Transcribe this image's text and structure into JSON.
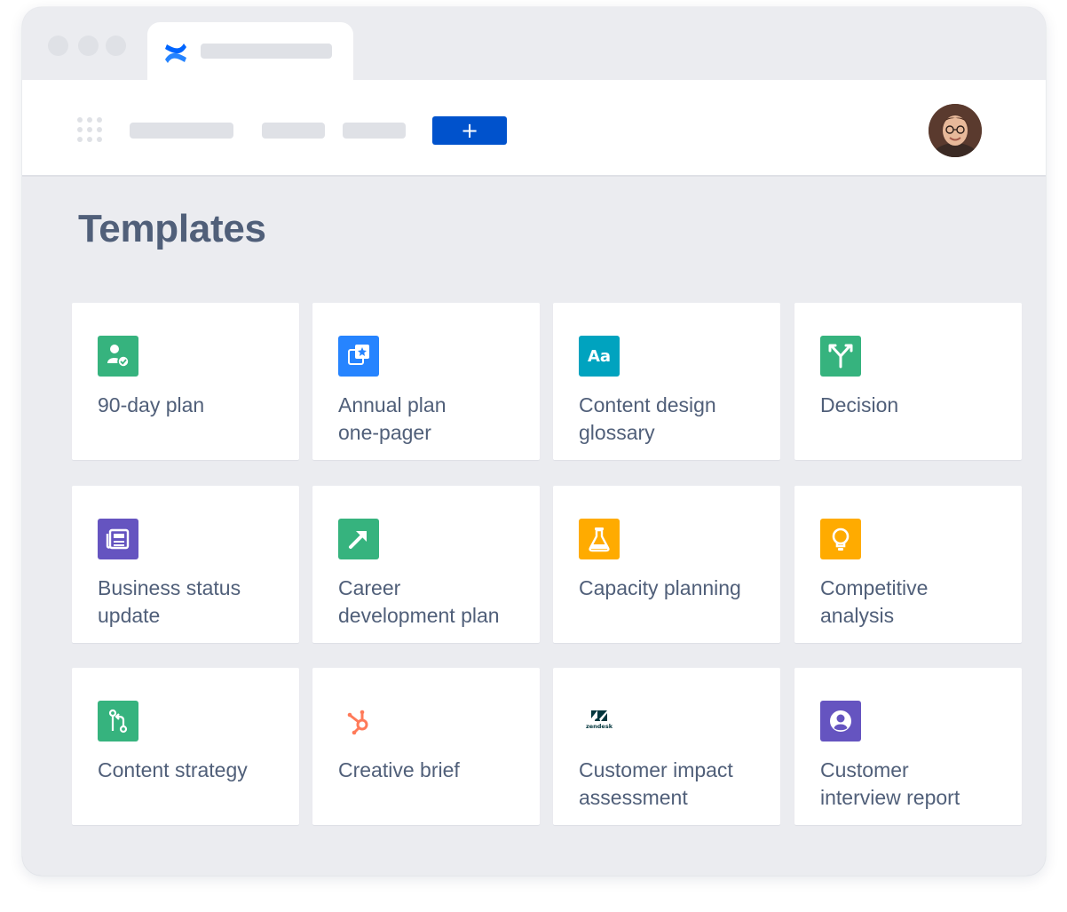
{
  "create_button": {
    "label": "+"
  },
  "page": {
    "title": "Templates"
  },
  "colors": {
    "primary": "#0052cc",
    "heading": "#505f79",
    "background": "#ebecf0",
    "placeholder": "#dfe1e6"
  },
  "templates": [
    {
      "label": "90-day plan",
      "icon": "person-check-icon",
      "icon_bg": "#36b37e"
    },
    {
      "label": "Annual plan\none-pager",
      "icon": "calendar-star-icon",
      "icon_bg": "#2684ff"
    },
    {
      "label": "Content design\nglossary",
      "icon": "text-aa-icon",
      "icon_bg": "#00a3bf"
    },
    {
      "label": "Decision",
      "icon": "fork-arrow-icon",
      "icon_bg": "#36b37e"
    },
    {
      "label": "Business status\nupdate",
      "icon": "newspaper-icon",
      "icon_bg": "#6554c0"
    },
    {
      "label": "Career\ndevelopment plan",
      "icon": "arrow-up-right-icon",
      "icon_bg": "#36b37e"
    },
    {
      "label": "Capacity planning",
      "icon": "flask-icon",
      "icon_bg": "#ffab00"
    },
    {
      "label": "Competitive\nanalysis",
      "icon": "lightbulb-icon",
      "icon_bg": "#ffab00"
    },
    {
      "label": "Content strategy",
      "icon": "branch-icon",
      "icon_bg": "#36b37e"
    },
    {
      "label": "Creative brief",
      "icon": "hubspot-icon",
      "icon_bg": "#ff7a59"
    },
    {
      "label": "Customer impact\nassessment",
      "icon": "zendesk-icon",
      "icon_bg": "#03363d",
      "icon_text": "zendesk"
    },
    {
      "label": "Customer\ninterview report",
      "icon": "user-circle-icon",
      "icon_bg": "#6554c0"
    }
  ]
}
